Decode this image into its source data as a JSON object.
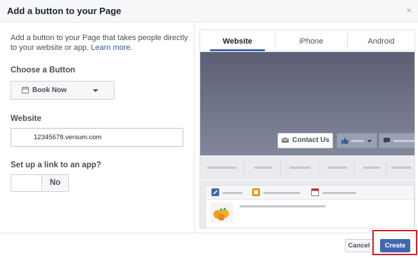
{
  "dialog": {
    "title": "Add a button to your Page",
    "close_glyph": "×"
  },
  "left": {
    "description": "Add a button to your Page that takes people directly to your website or app.",
    "learn_more": "Learn more.",
    "choose_label": "Choose a Button",
    "choose_value": "Book Now",
    "website_label": "Website",
    "website_value": "12345678.versum.com",
    "app_label": "Set up a link to an app?",
    "app_toggle_value": "No"
  },
  "preview": {
    "tabs": [
      {
        "label": "Website",
        "active": true
      },
      {
        "label": "iPhone",
        "active": false
      },
      {
        "label": "Android",
        "active": false
      }
    ],
    "contact_button": "Contact Us"
  },
  "footer": {
    "cancel_label": "Cancel",
    "create_label": "Create"
  },
  "colors": {
    "accent": "#4267b2",
    "highlight": "#d0202a",
    "link": "#365899"
  },
  "icons": {
    "calendar": "calendar-icon",
    "caret": "chevron-down-icon",
    "mail": "envelope-icon",
    "like": "thumbs-up-icon",
    "message": "message-icon",
    "close": "close-icon"
  }
}
